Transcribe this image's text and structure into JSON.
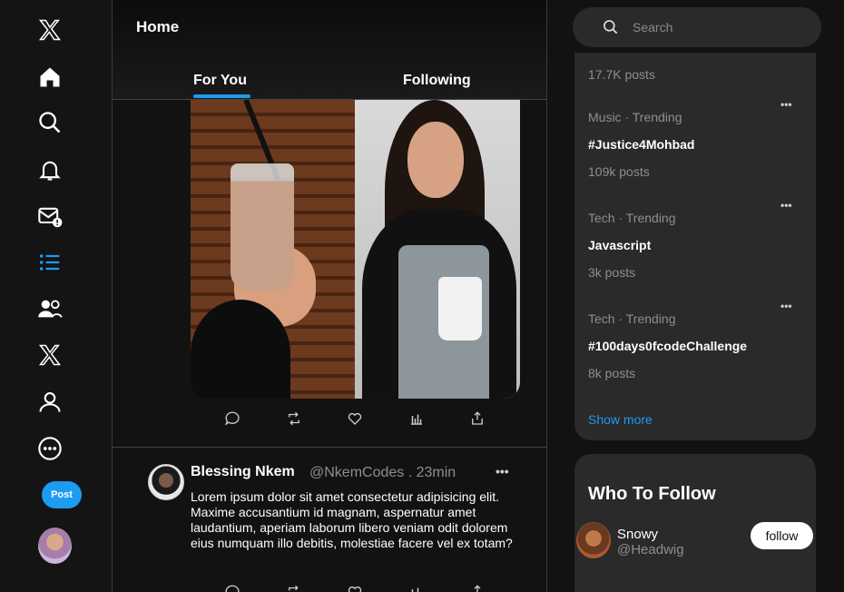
{
  "nav": {
    "post_label": "Post"
  },
  "header": {
    "title": "Home",
    "tabs": [
      {
        "label": "For You",
        "active": true
      },
      {
        "label": "Following",
        "active": false
      }
    ],
    "accent": "#1d9bf0"
  },
  "tweet": {
    "name": "Blessing Nkem",
    "handle_time": "@NkemCodes . 23min",
    "more": "•••",
    "text": "Lorem ipsum dolor sit amet consectetur adipisicing elit. Maxime accusantium id magnam, aspernatur amet laudantium, aperiam laborum libero veniam odit dolorem eius numquam illo debitis, molestiae facere vel ex totam?"
  },
  "search": {
    "placeholder": "Search"
  },
  "trends": {
    "top_count": "17.7K posts",
    "items": [
      {
        "category": "Music · Trending",
        "topic": "#Justice4Mohbad",
        "count": "109k posts"
      },
      {
        "category": "Tech · Trending",
        "topic": "Javascript",
        "count": "3k posts"
      },
      {
        "category": "Tech · Trending",
        "topic": "#100days0fcodeChallenge",
        "count": "8k posts"
      }
    ],
    "more_glyph": "•••",
    "show_more": "Show more"
  },
  "who_to_follow": {
    "title": "Who To Follow",
    "user": {
      "name": "Snowy",
      "handle": "@Headwig",
      "button": "follow"
    }
  }
}
